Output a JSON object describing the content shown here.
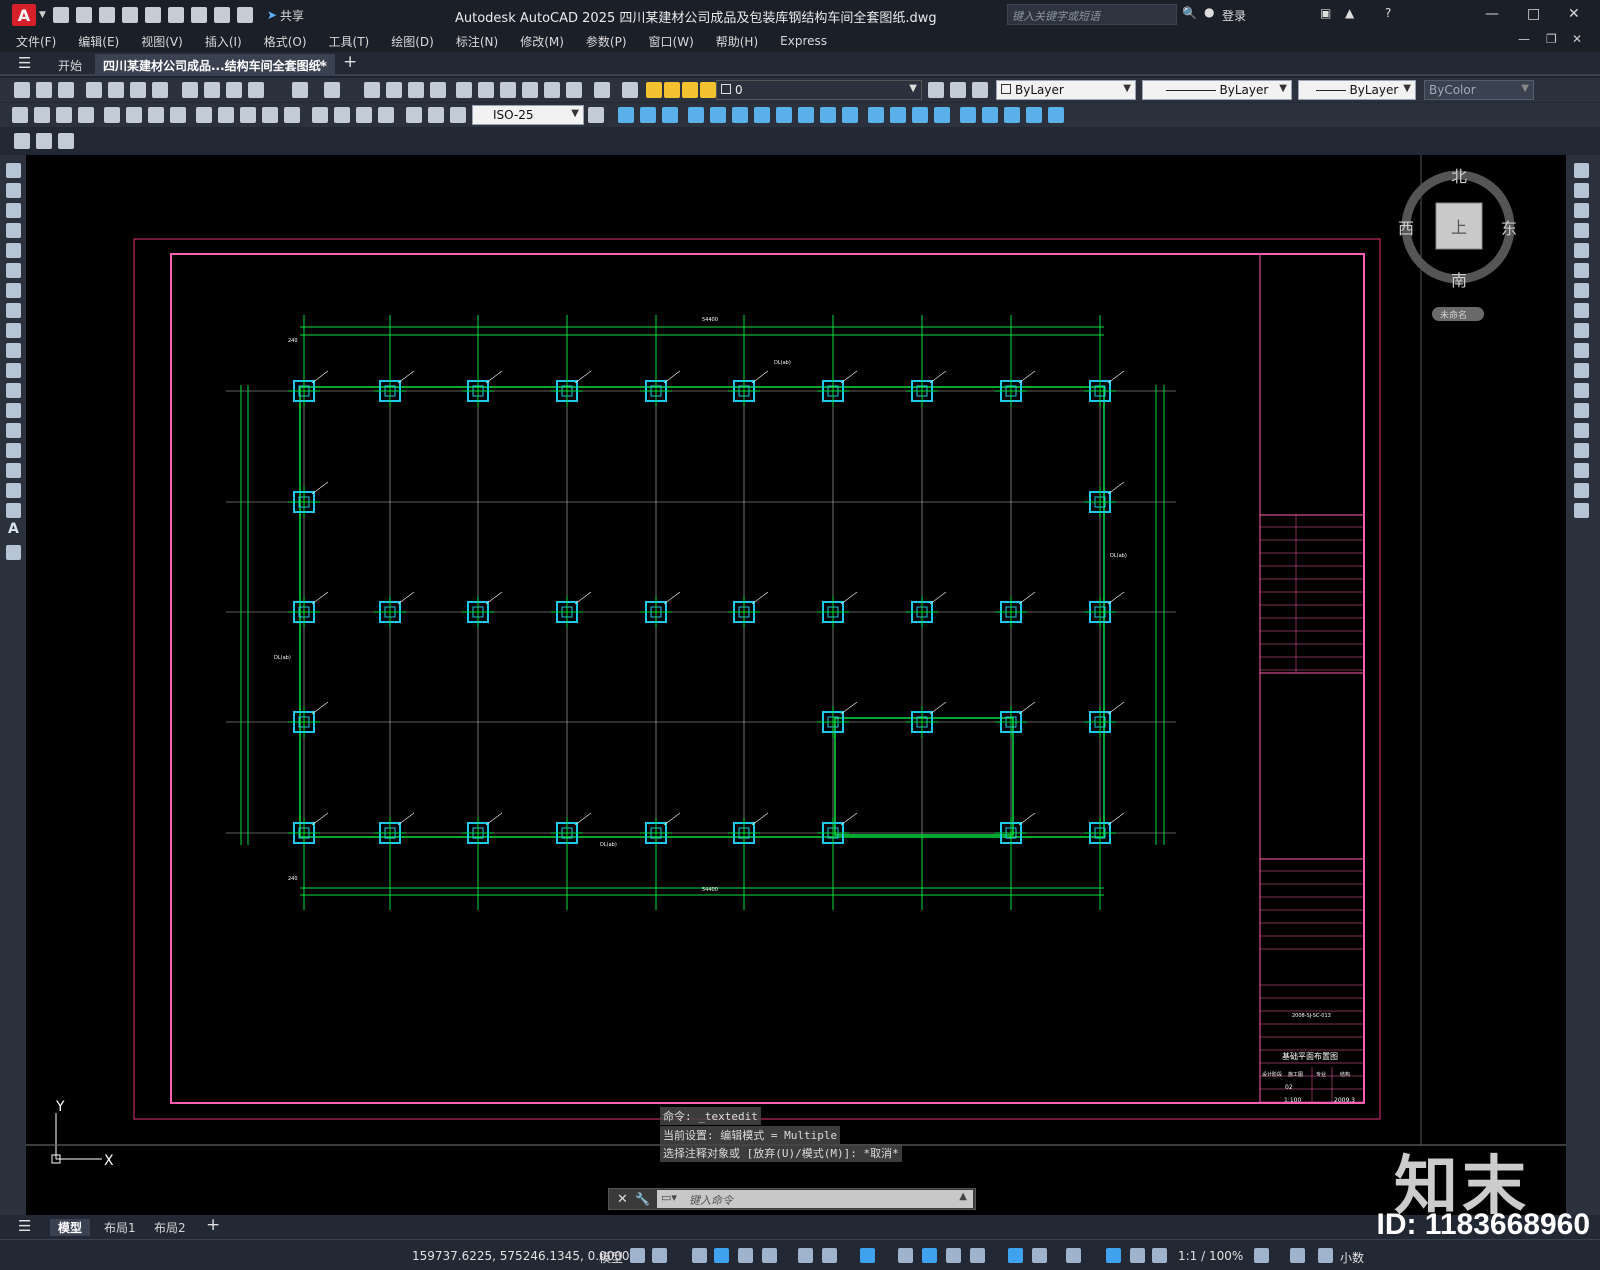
{
  "app": {
    "logo_letter": "A",
    "title": "Autodesk AutoCAD 2025    四川某建材公司成品及包装库钢结构车间全套图纸.dwg",
    "share_label": "共享",
    "search_placeholder": "键入关键字或短语",
    "login_label": "登录"
  },
  "menu": [
    "文件(F)",
    "编辑(E)",
    "视图(V)",
    "插入(I)",
    "格式(O)",
    "工具(T)",
    "绘图(D)",
    "标注(N)",
    "修改(M)",
    "参数(P)",
    "窗口(W)",
    "帮助(H)",
    "Express"
  ],
  "tabs": {
    "start": "开始",
    "doc": "四川某建材公司成品...结构车间全套图纸*",
    "close": "×",
    "add": "+"
  },
  "properties": {
    "layer_value": "0",
    "color": "ByLayer",
    "linetype": "ByLayer",
    "lineweight": "ByLayer",
    "plotstyle": "ByColor",
    "dimstyle": "ISO-25"
  },
  "viewcube": {
    "north": "北",
    "south": "南",
    "east": "东",
    "west": "西",
    "face": "上",
    "ucs_name": "未命名"
  },
  "ucs": {
    "y": "Y",
    "x": "X"
  },
  "drawing": {
    "overall_dim": "54400",
    "bay_dim": "6000",
    "edge_dim": "240",
    "side_dim": "7500",
    "footing_label_1": "JC-1",
    "footing_label_2": "JC-2",
    "footing_label_3": "JC-3",
    "beam_label": "DL(ab)"
  },
  "title_block": {
    "project_no": "2008-SJ-SC-013",
    "drawing_name": "基础平面布置图",
    "stage": "施工图",
    "sheet_no": "02",
    "scale": "1:100",
    "date": "2009.3",
    "label_stage": "设计阶段",
    "label_major": "专业",
    "label_major_value": "结构"
  },
  "command": {
    "line1": "命令: _textedit",
    "line2": "当前设置: 编辑模式 = Multiple",
    "line3": "选择注释对象或 [放弃(U)/模式(M)]: *取消*",
    "input_placeholder": "键入命令"
  },
  "layouts": [
    "模型",
    "布局1",
    "布局2"
  ],
  "status": {
    "coords": "159737.6225, 575246.1345, 0.0000",
    "mode": "模型",
    "scale": "1:1 / 100%",
    "units": "小数"
  },
  "watermark": {
    "logo": "知末",
    "id": "ID: 1183668960"
  }
}
